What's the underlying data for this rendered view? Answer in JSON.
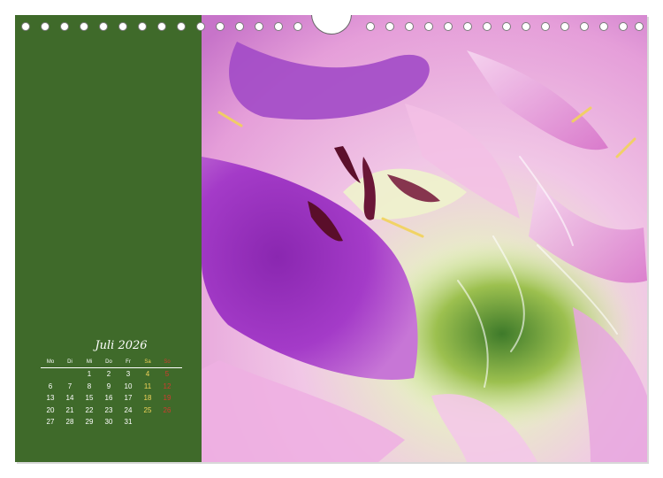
{
  "colors": {
    "panel_green": "#3f6a2a",
    "saturday": "#f2d35a",
    "sunday": "#d13a2f"
  },
  "image": {
    "subject": "pink-purple-flower-closeup"
  },
  "calendar": {
    "title": "Juli 2026",
    "weekdays": [
      "Mo",
      "Di",
      "Mi",
      "Do",
      "Fr",
      "Sa",
      "So"
    ],
    "weeks": [
      [
        "",
        "",
        "1",
        "2",
        "3",
        "4",
        "5"
      ],
      [
        "6",
        "7",
        "8",
        "9",
        "10",
        "11",
        "12"
      ],
      [
        "13",
        "14",
        "15",
        "16",
        "17",
        "18",
        "19"
      ],
      [
        "20",
        "21",
        "22",
        "23",
        "24",
        "25",
        "26"
      ],
      [
        "27",
        "28",
        "29",
        "30",
        "31",
        "",
        ""
      ]
    ]
  }
}
